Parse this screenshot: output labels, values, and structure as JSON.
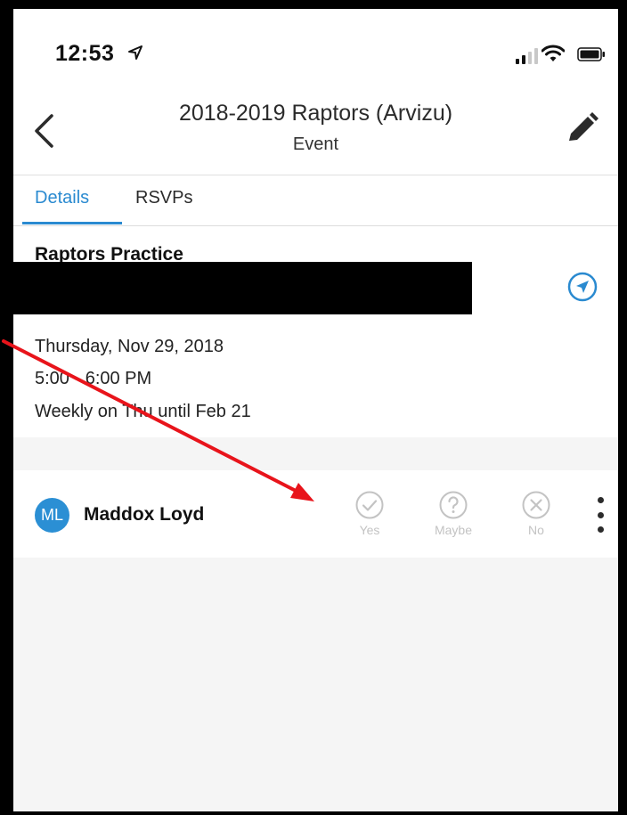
{
  "status_bar": {
    "time": "12:53"
  },
  "header": {
    "title": "2018-2019 Raptors (Arvizu)",
    "subtitle": "Event"
  },
  "tabs": [
    {
      "label": "Details",
      "active": true
    },
    {
      "label": "RSVPs",
      "active": false
    }
  ],
  "event": {
    "title": "Raptors Practice",
    "date": "Thursday, Nov 29, 2018",
    "time": "5:00 - 6:00 PM",
    "recurrence": "Weekly on Thu until Feb 21"
  },
  "attendee": {
    "initials": "ML",
    "name": "Maddox Loyd",
    "rsvp_options": [
      {
        "label": "Yes",
        "icon": "check-circle-icon"
      },
      {
        "label": "Maybe",
        "icon": "question-circle-icon"
      },
      {
        "label": "No",
        "icon": "x-circle-icon"
      }
    ]
  },
  "colors": {
    "accent": "#2a8ad0",
    "avatar": "#2b8fd4",
    "rsvp_inactive": "#c3c3c3",
    "annotation_arrow": "#e8141b",
    "background": "#f5f5f5"
  }
}
